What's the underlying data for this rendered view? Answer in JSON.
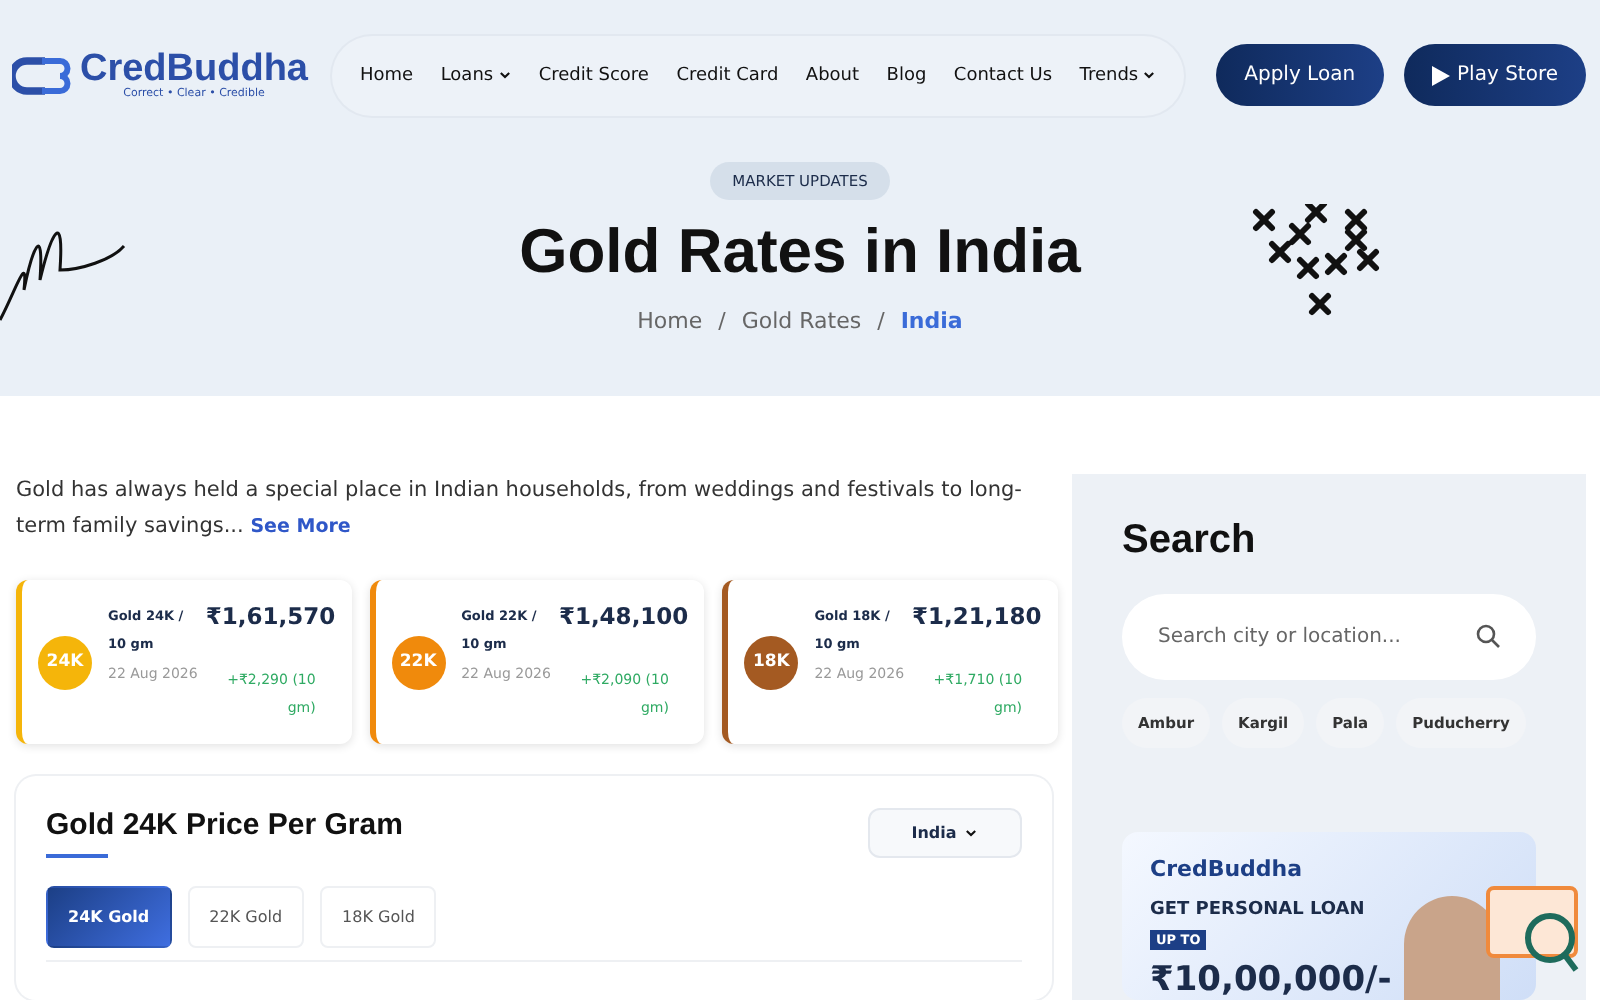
{
  "header": {
    "logo": {
      "name": "CredBuddha",
      "tagline": "Correct • Clear • Credible"
    },
    "nav": [
      {
        "label": "Home",
        "dropdown": false
      },
      {
        "label": "Loans",
        "dropdown": true
      },
      {
        "label": "Credit Score",
        "dropdown": false
      },
      {
        "label": "Credit Card",
        "dropdown": false
      },
      {
        "label": "About",
        "dropdown": false
      },
      {
        "label": "Blog",
        "dropdown": false
      },
      {
        "label": "Contact Us",
        "dropdown": false
      },
      {
        "label": "Trends",
        "dropdown": true
      }
    ],
    "buttons": [
      {
        "label": "Apply Loan",
        "kind": "plain"
      },
      {
        "label": "Play Store",
        "kind": "play"
      }
    ]
  },
  "hero": {
    "badge": "MARKET UPDATES",
    "title": "Gold Rates in India",
    "separator": "/",
    "breadcrumb": [
      {
        "label": "Home",
        "selected": false
      },
      {
        "label": "Gold Rates",
        "selected": false
      },
      {
        "label": "India",
        "selected": true
      }
    ]
  },
  "intro": {
    "text": "Gold has always held a special place in Indian households, from weddings and festivals to long-term family savings...",
    "link": "See More"
  },
  "rate_cards": [
    {
      "badge": "24K",
      "color": "#f5b50a",
      "label": "Gold 24K / 10 gm",
      "price": "₹1,61,570",
      "change": "+₹2,290 (10 gm)",
      "date": "22 Aug 2026"
    },
    {
      "badge": "22K",
      "color": "#f08a0c",
      "label": "Gold 22K / 10 gm",
      "price": "₹1,48,100",
      "change": "+₹2,090 (10 gm)",
      "date": "22 Aug 2026"
    },
    {
      "badge": "18K",
      "color": "#a45a22",
      "label": "Gold 18K / 10 gm",
      "price": "₹1,21,180",
      "change": "+₹1,710 (10 gm)",
      "date": "22 Aug 2026"
    }
  ],
  "price_panel": {
    "title": "Gold 24K Price Per Gram",
    "location": "India",
    "tabs": [
      {
        "label": "24K Gold",
        "selected": true
      },
      {
        "label": "22K Gold",
        "selected": false
      },
      {
        "label": "18K Gold",
        "selected": false
      }
    ]
  },
  "sidebar": {
    "title": "Search",
    "search": {
      "placeholder": "Search city or location..."
    },
    "cities": [
      "Ambur",
      "Kargil",
      "Pala",
      "Puducherry"
    ],
    "ad": {
      "brand": "CredBuddha",
      "headline": "GET PERSONAL LOAN",
      "tag": "UP TO",
      "amount": "₹10,00,000/-"
    }
  }
}
